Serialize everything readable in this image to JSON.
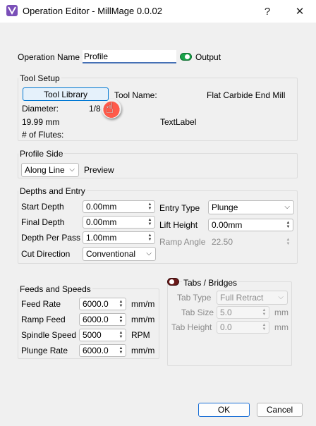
{
  "window": {
    "title": "Operation Editor - MillMage 0.0.02",
    "help_glyph": "?",
    "close_glyph": "✕"
  },
  "operation": {
    "name_label": "Operation Name",
    "name_value": "Profile",
    "output_label": "Output"
  },
  "tool_setup": {
    "title": "Tool Setup",
    "tool_library_button": "Tool Library",
    "tool_name_label": "Tool Name:",
    "tool_name_value": "Flat Carbide End Mill",
    "diameter_label": "Diameter:",
    "diameter_fraction": "1/8",
    "diameter_mm": "19.99 mm",
    "text_label": "TextLabel",
    "flutes_label": "# of Flutes:"
  },
  "profile_side": {
    "title": "Profile Side",
    "side_value": "Along Line",
    "preview_label": "Preview"
  },
  "depths": {
    "title": "Depths and Entry",
    "start_depth_label": "Start Depth",
    "start_depth_value": "0.00mm",
    "final_depth_label": "Final Depth",
    "final_depth_value": "0.00mm",
    "depth_per_pass_label": "Depth Per Pass",
    "depth_per_pass_value": "1.00mm",
    "cut_direction_label": "Cut Direction",
    "cut_direction_value": "Conventional",
    "entry_type_label": "Entry Type",
    "entry_type_value": "Plunge",
    "lift_height_label": "Lift Height",
    "lift_height_value": "0.00mm",
    "ramp_angle_label": "Ramp Angle",
    "ramp_angle_value": "22.50"
  },
  "feeds": {
    "title": "Feeds and Speeds",
    "feed_rate_label": "Feed Rate",
    "feed_rate_value": "6000.0",
    "feed_rate_unit": "mm/m",
    "ramp_feed_label": "Ramp Feed",
    "ramp_feed_value": "6000.0",
    "ramp_feed_unit": "mm/m",
    "spindle_speed_label": "Spindle Speed",
    "spindle_speed_value": "5000",
    "spindle_speed_unit": "RPM",
    "plunge_rate_label": "Plunge Rate",
    "plunge_rate_value": "6000.0",
    "plunge_rate_unit": "mm/m"
  },
  "tabs": {
    "title": "Tabs / Bridges",
    "tab_type_label": "Tab Type",
    "tab_type_value": "Full Retract",
    "tab_size_label": "Tab Size",
    "tab_size_value": "5.0",
    "tab_size_unit": "mm",
    "tab_height_label": "Tab Height",
    "tab_height_value": "0.0",
    "tab_height_unit": "mm"
  },
  "actions": {
    "ok_label": "OK",
    "cancel_label": "Cancel"
  },
  "colors": {
    "accent": "#0078d4",
    "output_toggle_on": "#1aa34a",
    "tabs_toggle_off": "#6a1a1a",
    "app_icon": "#7a4fb8"
  }
}
